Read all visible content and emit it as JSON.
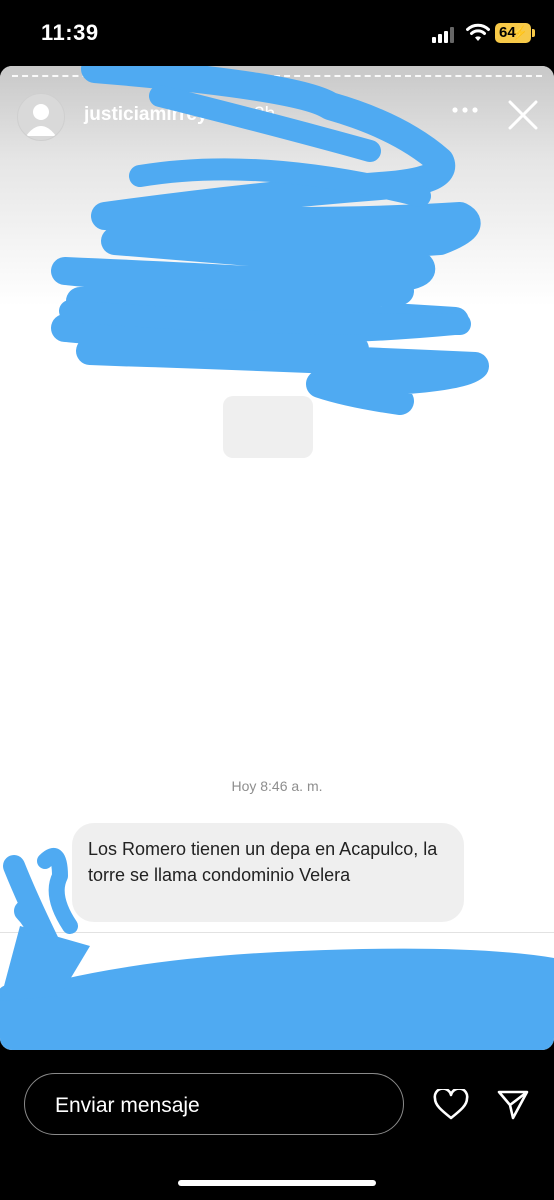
{
  "status_bar": {
    "time": "11:39",
    "battery": "64",
    "icons": [
      "signal-icon",
      "wifi-icon",
      "battery-charging-icon"
    ]
  },
  "story": {
    "username": "justiciamirreyes",
    "time_ago": "3h",
    "icons": [
      "more-icon",
      "close-icon"
    ]
  },
  "conversation": {
    "timestamp": "Hoy 8:46 a. m.",
    "message": "Los Romero tienen un depa en Acapulco, la torre se llama condominio Velera"
  },
  "redaction_color": "#4faaf2",
  "footer": {
    "input_placeholder": "Enviar mensaje",
    "icons": [
      "heart-icon",
      "send-icon"
    ]
  }
}
